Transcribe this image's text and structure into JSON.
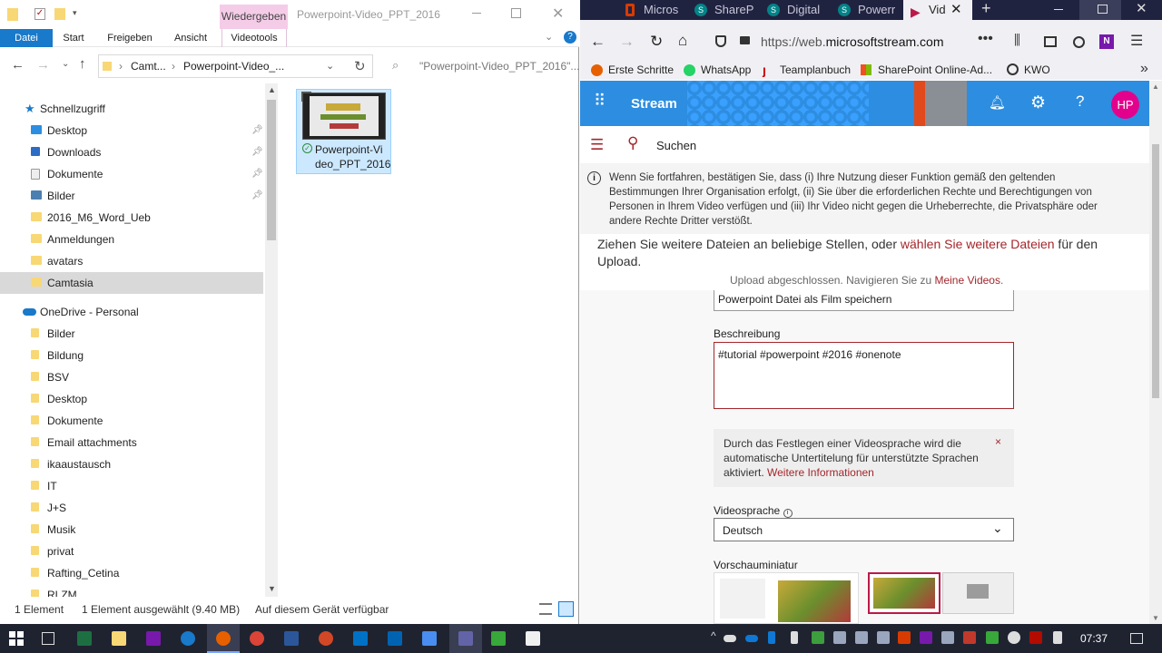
{
  "explorer": {
    "contextual_tab_label": "Wiedergeben",
    "window_title": "Powerpoint-Video_PPT_2016",
    "ribbon_tabs": [
      "Datei",
      "Start",
      "Freigeben",
      "Ansicht",
      "Videotools"
    ],
    "breadcrumb": [
      "Camt...",
      "Powerpoint-Video_..."
    ],
    "search_placeholder": "\"Powerpoint-Video_PPT_2016\"...",
    "quick_access_label": "Schnellzugriff",
    "quick_access": [
      {
        "label": "Desktop",
        "pinned": true,
        "icon": "desktop-icon"
      },
      {
        "label": "Downloads",
        "pinned": true,
        "icon": "download-icon"
      },
      {
        "label": "Dokumente",
        "pinned": true,
        "icon": "document-icon"
      },
      {
        "label": "Bilder",
        "pinned": true,
        "icon": "pictures-icon"
      },
      {
        "label": "2016_M6_Word_Ueb",
        "pinned": false,
        "icon": "folder-icon"
      },
      {
        "label": "Anmeldungen",
        "pinned": false,
        "icon": "folder-icon"
      },
      {
        "label": "avatars",
        "pinned": false,
        "icon": "folder-icon"
      },
      {
        "label": "Camtasia",
        "pinned": false,
        "icon": "folder-icon",
        "selected": true
      }
    ],
    "onedrive_label": "OneDrive - Personal",
    "onedrive_items": [
      "Bilder",
      "Bildung",
      "BSV",
      "Desktop",
      "Dokumente",
      "Email attachments",
      "ikaaustausch",
      "IT",
      "J+S",
      "Musik",
      "privat",
      "Rafting_Cetina",
      "RLZM"
    ],
    "file": {
      "name_line1": "Powerpoint-Vi",
      "name_line2": "deo_PPT_2016"
    },
    "status": {
      "count": "1 Element",
      "selected": "1 Element ausgewählt (9.40 MB)",
      "availability": "Auf diesem Gerät verfügbar"
    }
  },
  "browser": {
    "tabs": [
      {
        "label": "Micros",
        "active": false
      },
      {
        "label": "ShareP",
        "active": false
      },
      {
        "label": "Digital",
        "active": false
      },
      {
        "label": "Powerr",
        "active": false
      },
      {
        "label": "Vid",
        "active": true
      }
    ],
    "url_prefix": "https://web.",
    "url_domain": "microsoftstream.com",
    "bookmarks": [
      "Erste Schritte",
      "WhatsApp",
      "Teamplanbuch",
      "SharePoint Online-Ad...",
      "KWO"
    ],
    "app_name": "Stream",
    "avatar_initials": "HP",
    "search_label": "Suchen",
    "notice": "Wenn Sie fortfahren, bestätigen Sie, dass (i) Ihre Nutzung dieser Funktion gemäß den geltenden Bestimmungen Ihrer Organisation erfolgt, (ii) Sie über die erforderlichen Rechte und Berechtigungen von Personen in Ihrem Video verfügen und (iii) Ihr Video nicht gegen die Urheberrechte, die Privatsphäre oder andere Rechte Dritter verstößt.",
    "drop_text_before": "Ziehen Sie weitere Dateien an beliebige Stellen, oder ",
    "drop_link": "wählen Sie weitere Dateien",
    "drop_text_after": " für den Upload.",
    "upload_done_before": "Upload abgeschlossen. Navigieren Sie zu ",
    "upload_done_link": "Meine Videos",
    "upload_done_after": ".",
    "title_value": "Powerpoint Datei als Film speichern",
    "description_label": "Beschreibung",
    "description_value": "#tutorial #powerpoint #2016 #onenote",
    "info_text": "Durch das Festlegen einer Videosprache wird die automatische Untertitelung für unterstützte Sprachen aktiviert. ",
    "info_link": "Weitere Informationen",
    "language_label": "Videosprache",
    "language_value": "Deutsch",
    "thumbnail_label": "Vorschauminiatur"
  },
  "taskbar": {
    "time": "07:37"
  },
  "colors": {
    "stream_blue": "#2d8de0",
    "accent": "#a4262c",
    "explorer_selected": "#cce8ff",
    "avatar": "#e3008c",
    "taskbar": "#1f2330"
  }
}
